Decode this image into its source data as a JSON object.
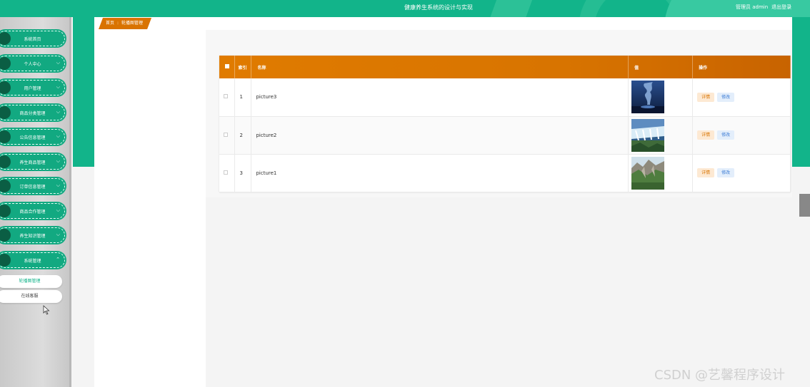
{
  "header": {
    "system_title": "健康养生系统的设计与实现",
    "user_label": "管理员 admin",
    "logout_label": "退出登录"
  },
  "sidebar": {
    "items": [
      {
        "label": "系统首页",
        "expandable": false
      },
      {
        "label": "个人中心",
        "expandable": true
      },
      {
        "label": "用户管理",
        "expandable": true
      },
      {
        "label": "商品分类管理",
        "expandable": true
      },
      {
        "label": "公告信息管理",
        "expandable": true
      },
      {
        "label": "养生商品管理",
        "expandable": true
      },
      {
        "label": "订单信息管理",
        "expandable": true
      },
      {
        "label": "商品合作管理",
        "expandable": true
      },
      {
        "label": "养生知识管理",
        "expandable": true
      },
      {
        "label": "系统管理",
        "expandable": true,
        "expanded": true
      }
    ],
    "subitems": [
      {
        "label": "轮播图管理",
        "active": true
      },
      {
        "label": "在线客服",
        "active": false
      }
    ]
  },
  "breadcrumb": {
    "home": "首页",
    "separator": ":",
    "current": "轮播图管理"
  },
  "table": {
    "columns": [
      "",
      "索引",
      "名称",
      "值",
      "操作"
    ],
    "rows": [
      {
        "index": "1",
        "name": "picture3",
        "image": "blue-night-scene"
      },
      {
        "index": "2",
        "name": "picture2",
        "image": "waterfall-scene"
      },
      {
        "index": "3",
        "name": "picture1",
        "image": "mountain-cliff-scene"
      }
    ],
    "actions": {
      "detail": "详情",
      "edit": "修改"
    }
  },
  "watermark": "CSDN @艺馨程序设计",
  "colors": {
    "primary": "#12b48a",
    "accent": "#d87400"
  }
}
